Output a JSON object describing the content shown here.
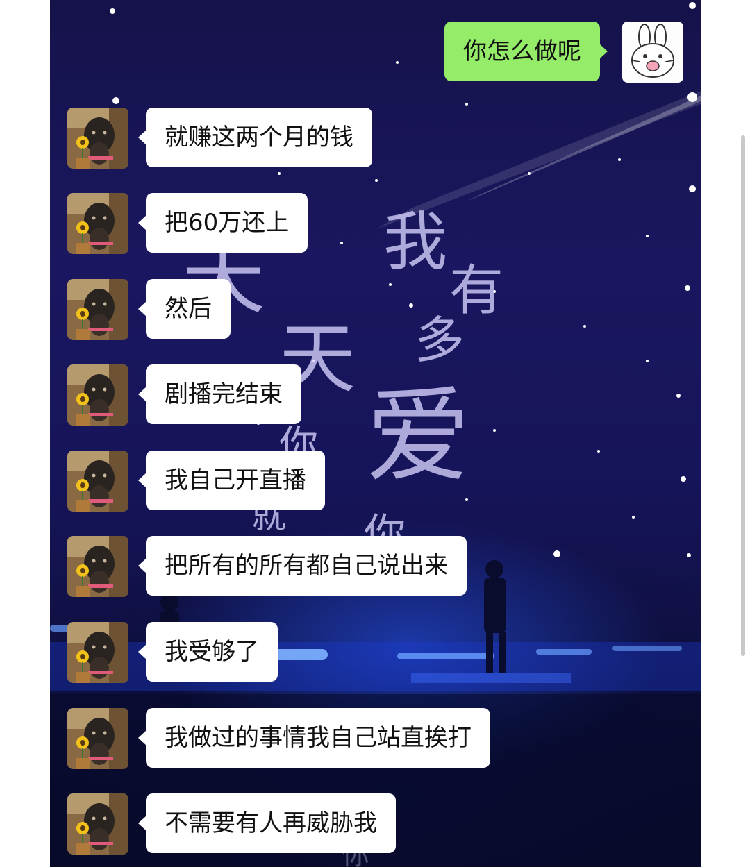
{
  "chat": {
    "outgoing": [
      {
        "text": "你怎么做呢",
        "avatar_icon": "bunny-avatar-icon"
      }
    ],
    "incoming": [
      {
        "text": "就赚这两个月的钱"
      },
      {
        "text": "把60万还上"
      },
      {
        "text": "然后"
      },
      {
        "text": "剧播完结束"
      },
      {
        "text": "我自己开直播"
      },
      {
        "text": "把所有的所有都自己说出来"
      },
      {
        "text": "我受够了"
      },
      {
        "text": "我做过的事情我自己站直挨打"
      },
      {
        "text": "不需要有人再威胁我"
      }
    ],
    "incoming_avatar_icon": "dog-sunflower-avatar-icon"
  },
  "background": {
    "lyrics": [
      "我",
      "有",
      "多",
      "爱",
      "你",
      "天",
      "天",
      "你",
      "就",
      "你"
    ]
  },
  "colors": {
    "outgoing_bubble": "#95ec69",
    "incoming_bubble": "#ffffff",
    "background_top": "#15124a",
    "stage_light": "#2e6bff"
  }
}
